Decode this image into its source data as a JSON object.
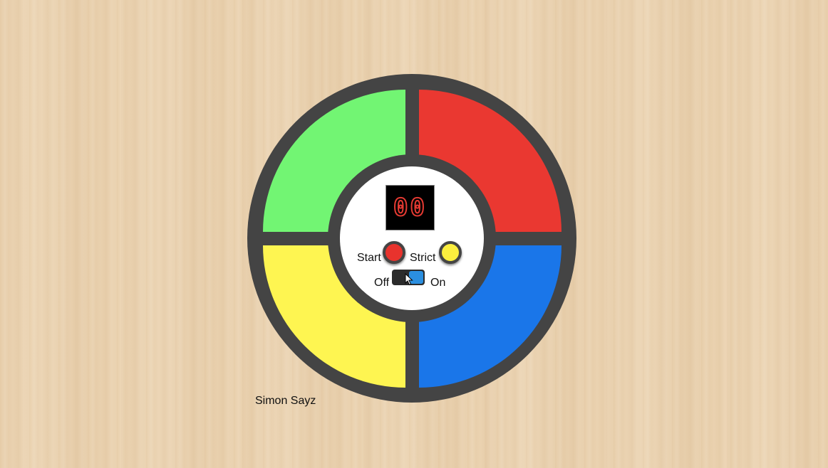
{
  "game": {
    "title": "Simon Sayz",
    "count_display": "00",
    "start_label": "Start",
    "strict_label": "Strict",
    "power_off_label": "Off",
    "power_on_label": "On",
    "power_state": "on"
  },
  "colors": {
    "board": "#444444",
    "green": "#72f573",
    "red": "#ea3831",
    "yellow": "#fef551",
    "blue": "#1a76e9",
    "start_button": "#e8332d",
    "strict_button": "#fbee3e",
    "switch_knob": "#2b8fe0",
    "display_digits": "#e53a32"
  },
  "icons": {
    "pointer": "mouse-pointer-icon"
  }
}
